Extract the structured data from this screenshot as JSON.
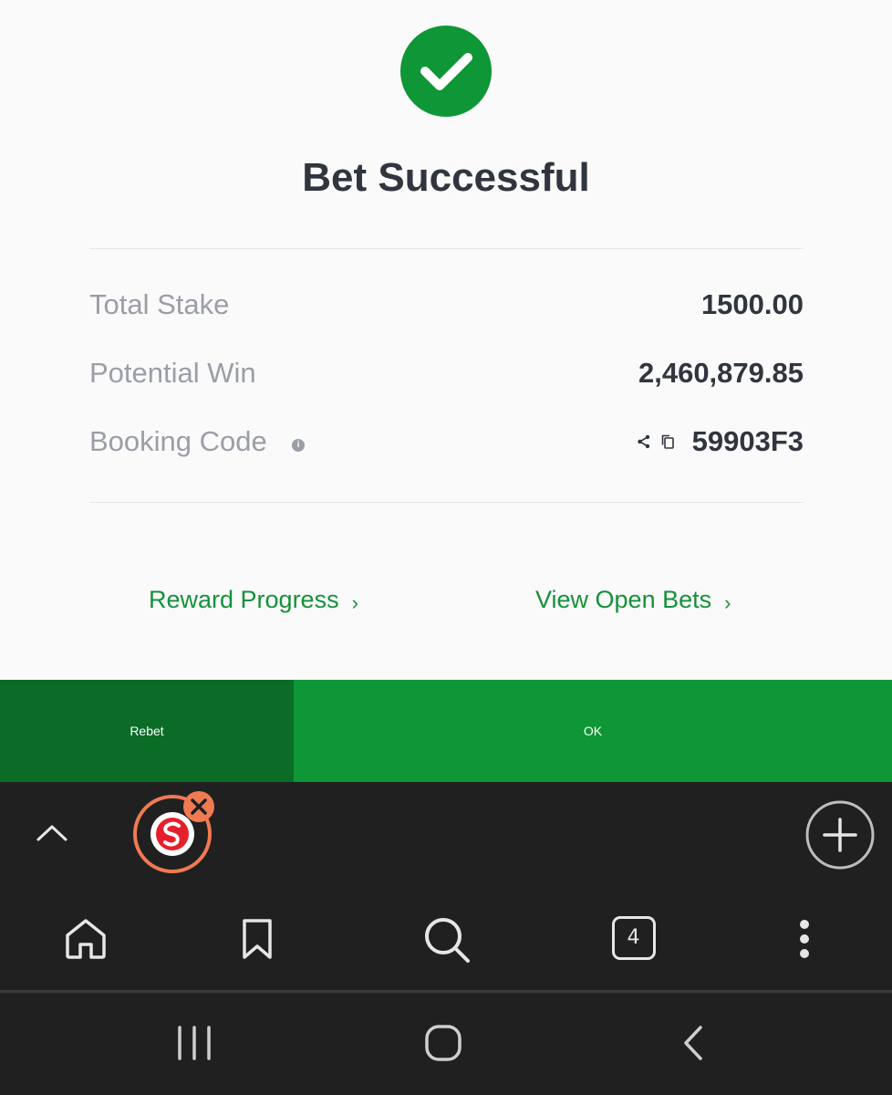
{
  "dialog": {
    "title": "Bet Successful",
    "rows": [
      {
        "label": "Total Stake",
        "value": "1500.00"
      },
      {
        "label": "Potential Win",
        "value": "2,460,879.85"
      },
      {
        "label": "Booking Code",
        "value": "59903F3"
      }
    ],
    "info_glyph": "i",
    "links": {
      "reward_progress": "Reward Progress",
      "view_open_bets": "View Open Bets",
      "chevron": "›"
    },
    "buttons": {
      "rebet": "Rebet",
      "ok": "OK"
    }
  },
  "browser": {
    "tab_count": "4",
    "icons": [
      "chevron-up-icon",
      "site-tab-icon",
      "close-icon",
      "new-tab-plus-icon",
      "home-icon",
      "bookmark-icon",
      "search-icon",
      "tabs-icon",
      "more-vert-icon"
    ]
  },
  "system_nav": {
    "icons": [
      "recents-icon",
      "home-circle-icon",
      "back-icon"
    ]
  },
  "colors": {
    "accent_green": "#0f9637",
    "dark_green": "#0b6c27",
    "link_green": "#15913b",
    "text_dark": "#30353f",
    "text_muted": "#9b9ea7",
    "site_badge_orange": "#f07a52",
    "site_badge_red": "#e5202d",
    "bar_dark": "#202020"
  }
}
